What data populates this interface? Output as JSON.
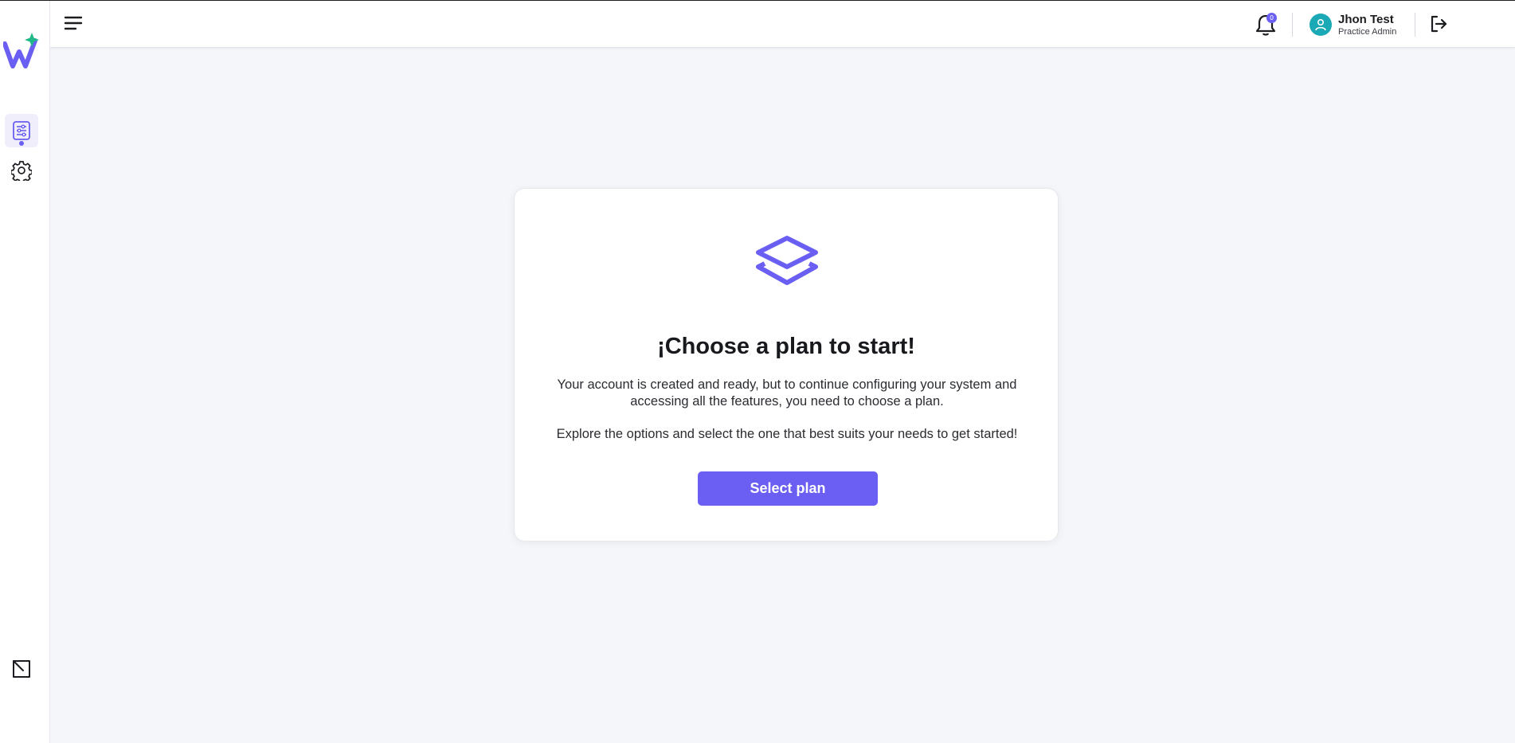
{
  "app": {
    "logo_name": "W"
  },
  "header": {
    "notifications_count": "0",
    "user": {
      "name": "Jhon Test",
      "role": "Practice Admin"
    }
  },
  "sidebar": {
    "items": [
      {
        "name": "dashboard",
        "icon": "sliders-list-icon",
        "active": true
      },
      {
        "name": "settings",
        "icon": "gear-icon",
        "active": false
      }
    ],
    "bottom_icon": "collapse-arrow-icon"
  },
  "card": {
    "icon": "layers-icon",
    "title": "¡Choose a plan to start!",
    "text_1": "Your account is created and ready, but to continue configuring your system and accessing all the features, you need to choose a plan.",
    "text_2": "Explore the options and select the one that best suits your needs to get started!",
    "button_label": "Select plan"
  },
  "colors": {
    "accent": "#6a5ff2",
    "logo_spark": "#1fb889",
    "avatar": "#1aa9b5",
    "background": "#f4f6f9"
  }
}
